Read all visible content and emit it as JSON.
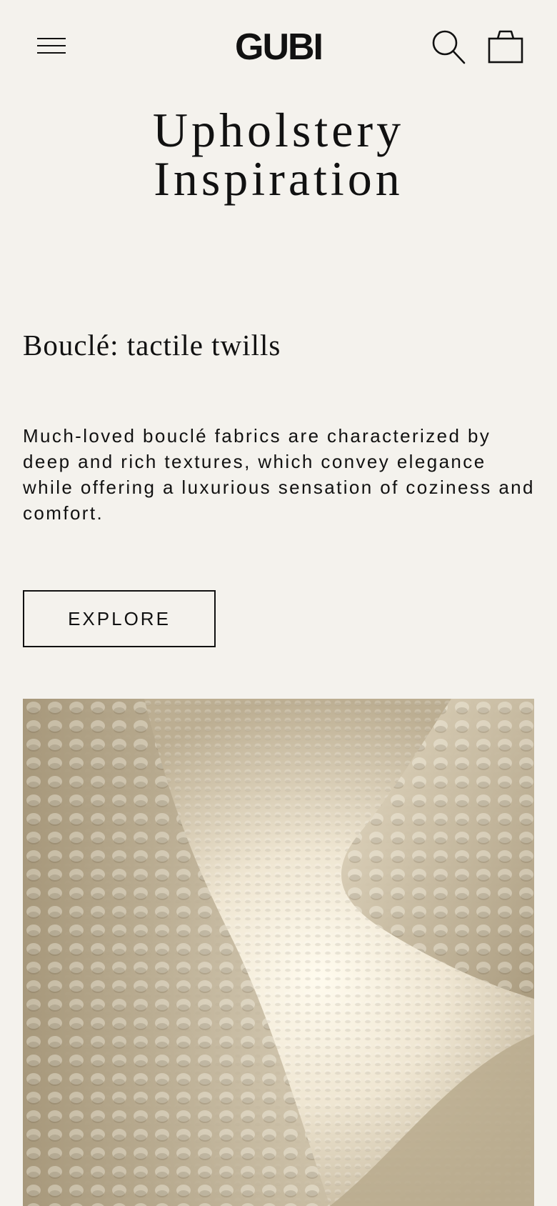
{
  "header": {
    "menu_icon": "hamburger-menu-icon",
    "logo": "GUBI",
    "search_icon": "search-icon",
    "cart_icon": "shopping-bag-icon"
  },
  "page": {
    "title_line1": "Upholstery",
    "title_line2": "Inspiration"
  },
  "section": {
    "heading": "Bouclé: tactile twills",
    "body": "Much-loved bouclé fabrics are characterized by deep and rich textures, which convey elegance while offering a luxurious sensation of coziness and comfort.",
    "button_label": "EXPLORE"
  },
  "colors": {
    "background": "#f4f2ed",
    "text": "#111111",
    "fabric_light": "#fbf7ea",
    "fabric_shadow": "#a89a7d"
  }
}
